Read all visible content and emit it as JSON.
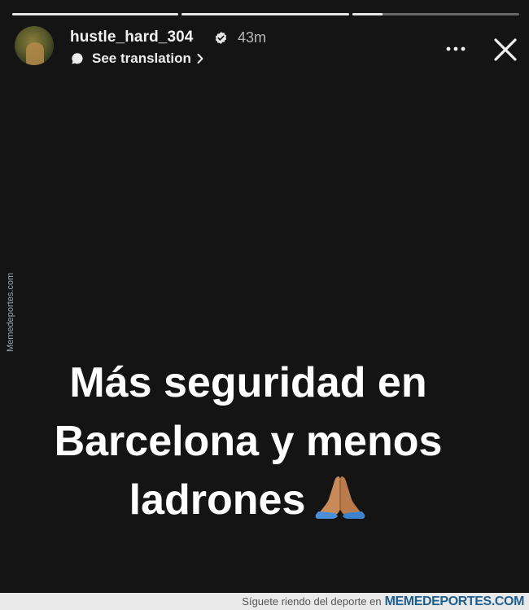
{
  "story": {
    "progress": [
      1.0,
      1.0,
      0.18
    ],
    "username": "hustle_hard_304",
    "verified": true,
    "time": "43m",
    "translate_label": "See translation",
    "caption_lines": [
      "Más seguridad en",
      "Barcelona y menos",
      "ladrones"
    ],
    "emoji": "folded-hands-icon"
  },
  "watermark": {
    "side_text": "Memedeportes.com",
    "footer_prefix": "Síguete riendo del deporte en",
    "footer_brand": "MEMEDEPORTES.COM"
  }
}
